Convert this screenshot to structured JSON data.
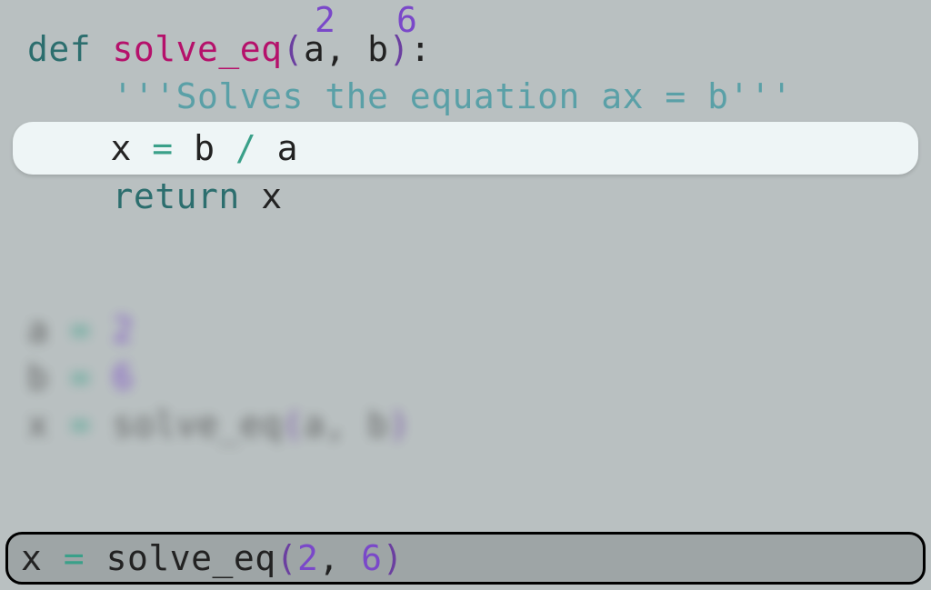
{
  "annotations": {
    "a_val": "2",
    "b_val": "6"
  },
  "def_line": {
    "kw": "def ",
    "fn": "solve_eq",
    "lp": "(",
    "p1": "a",
    "comma": ", ",
    "p2": "b",
    "rp": ")",
    "colon": ":"
  },
  "docstring": "    '''Solves the equation ax = b'''",
  "hl_line": {
    "indent": "    ",
    "x": "x",
    "sp1": " ",
    "eq": "=",
    "sp2": " ",
    "b": "b",
    "sp3": " ",
    "div": "/",
    "sp4": " ",
    "a": "a"
  },
  "ret_line": {
    "indent": "    ",
    "kw": "return",
    "sp": " ",
    "x": "x"
  },
  "lower": {
    "l1": {
      "a": "a",
      "sp1": " ",
      "eq": "=",
      "sp2": " ",
      "v": "2"
    },
    "l2": {
      "b": "b",
      "sp1": " ",
      "eq": "=",
      "sp2": " ",
      "v": "6"
    },
    "l3": {
      "x": "x",
      "sp1": " ",
      "eq": "=",
      "sp2": " ",
      "fn": "solve_eq",
      "lp": "(",
      "a": "a",
      "comma": ", ",
      "b": "b",
      "rp": ")"
    }
  },
  "bottom": {
    "x": "x",
    "sp1": " ",
    "eq": "=",
    "sp2": " ",
    "fn": "solve_eq",
    "lp": "(",
    "a": "2",
    "comma": ", ",
    "b": "6",
    "rp": ")"
  }
}
